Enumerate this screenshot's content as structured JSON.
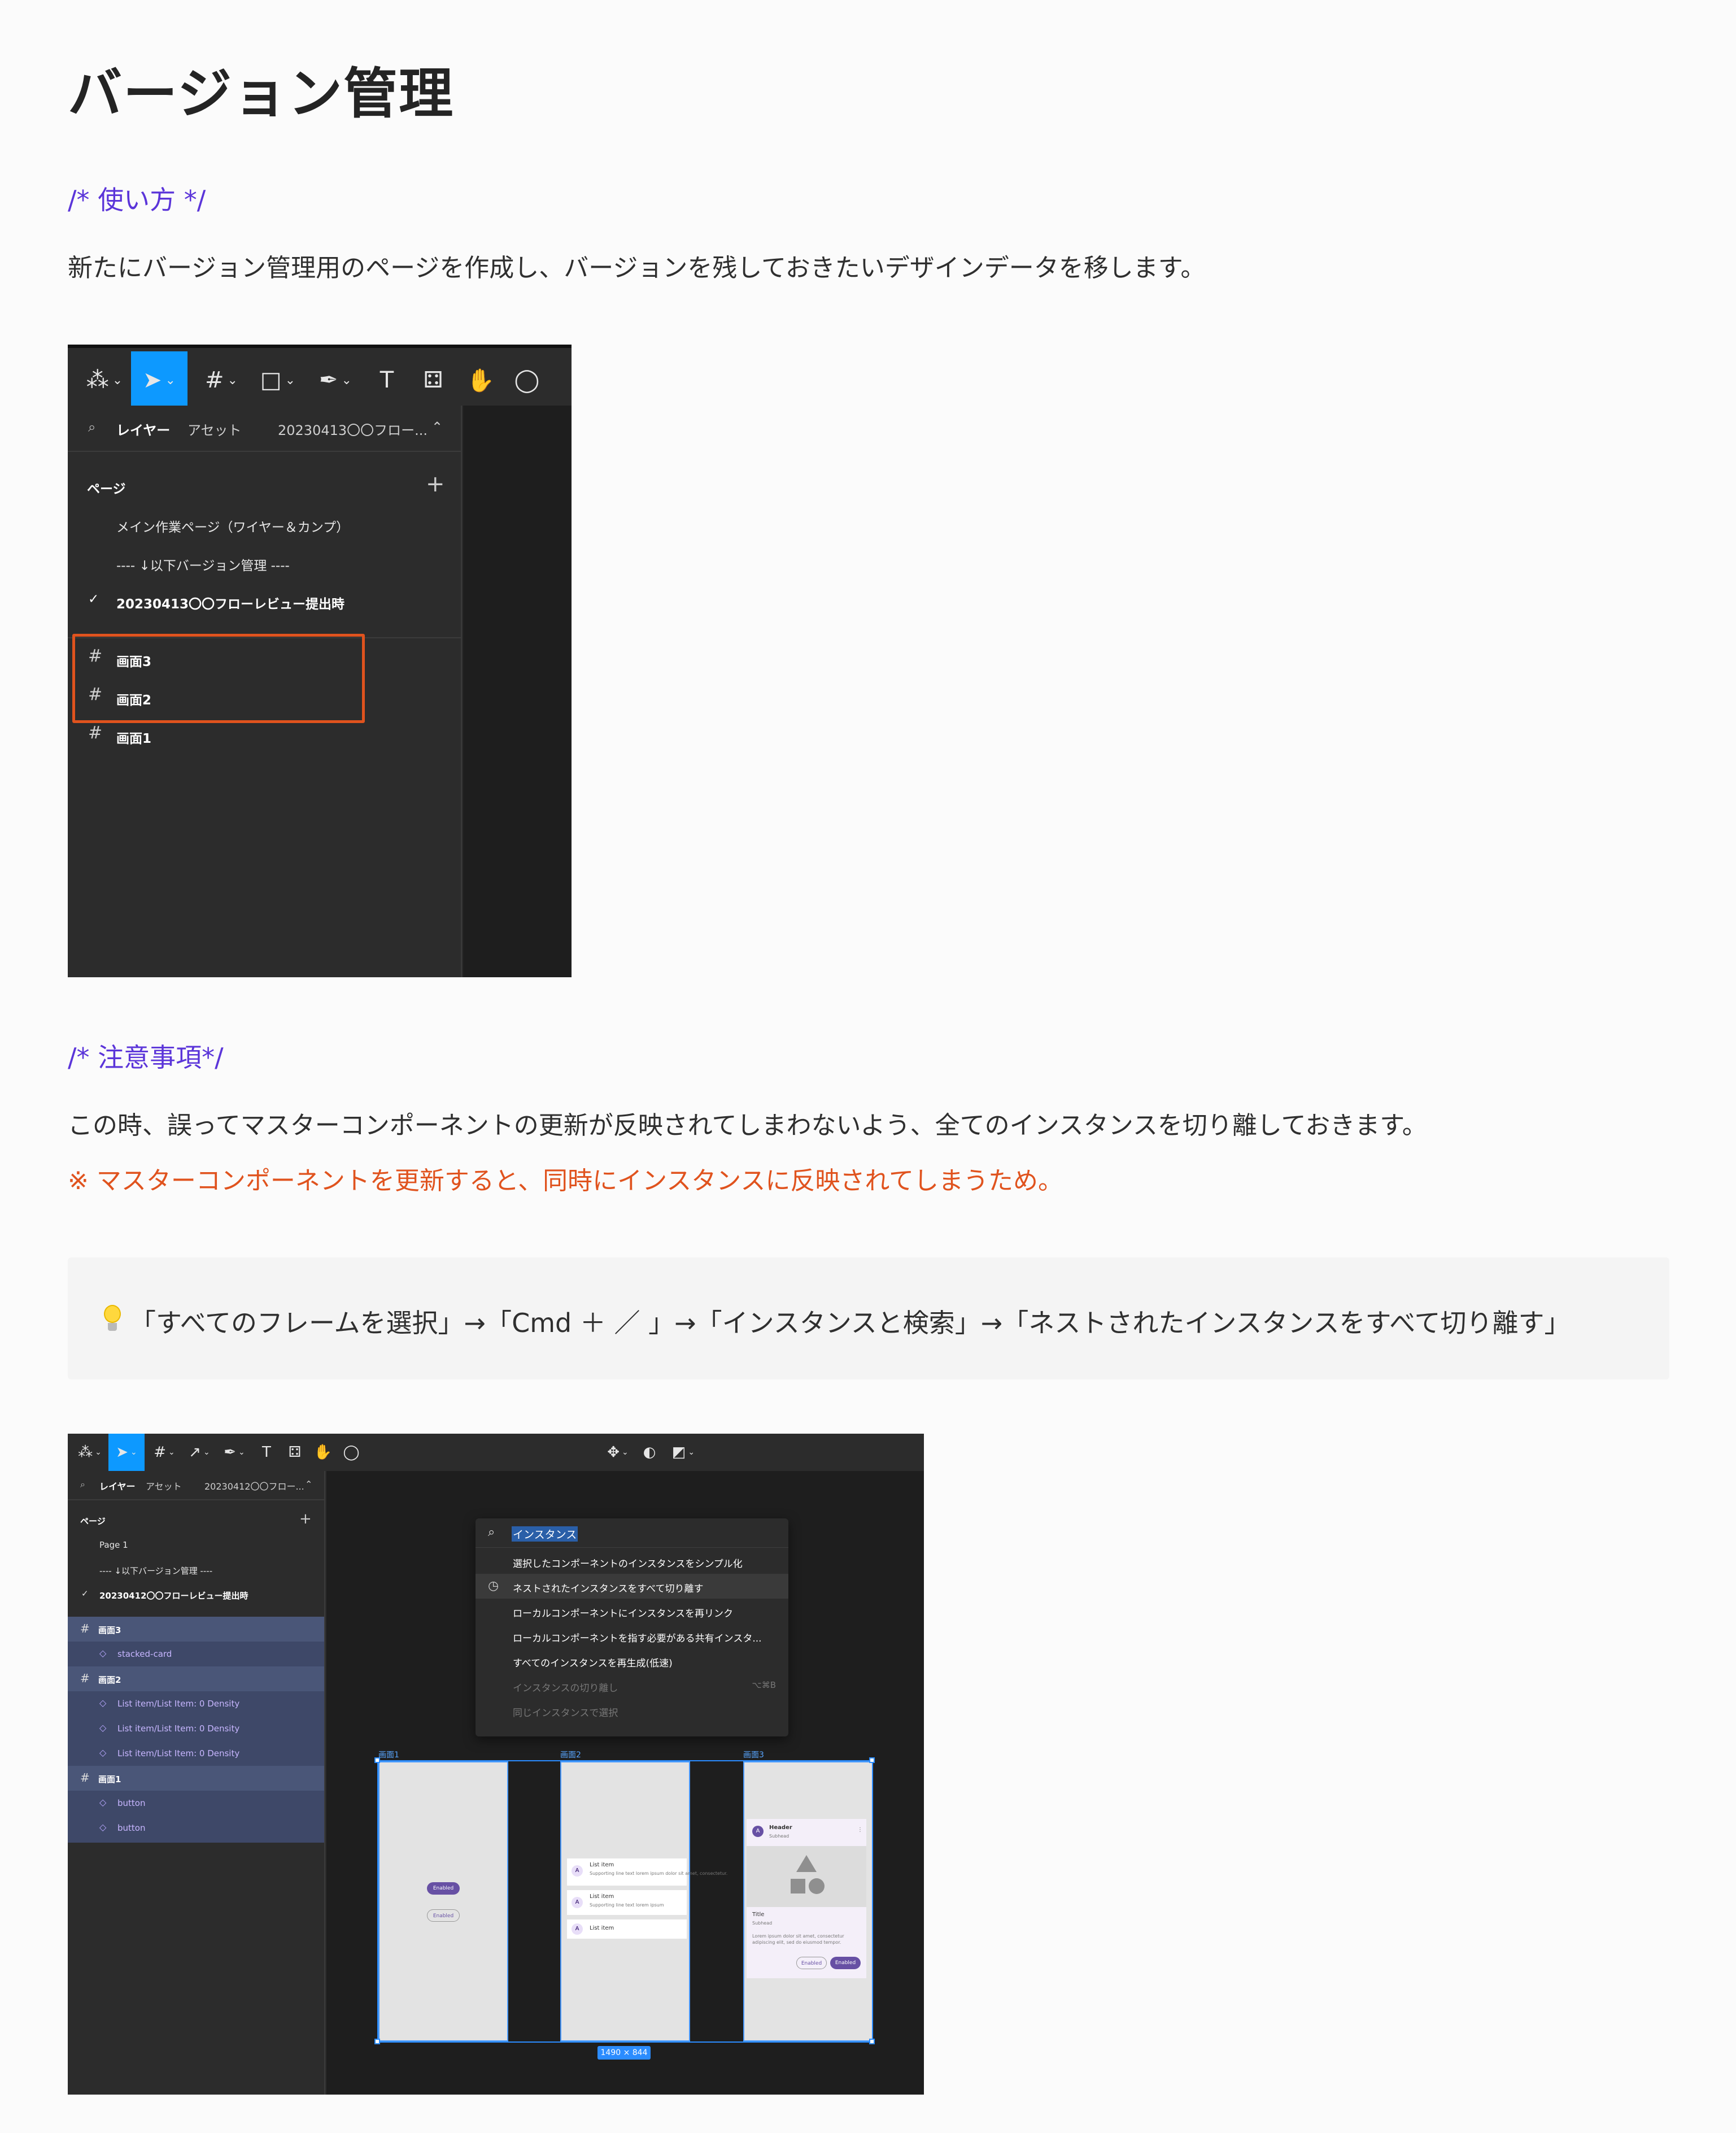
{
  "page": {
    "title": "バージョン管理",
    "section1_title": "/* 使い方 */",
    "section1_body": "新たにバージョン管理用のページを作成し、バージョンを残しておきたいデザインデータを移します。",
    "section2_title": "/* 注意事項*/",
    "section2_body": "この時、誤ってマスターコンポーネントの更新が反映されてしまわないよう、全てのインスタンスを切り離しておきます。",
    "section2_warning": "※ マスターコンポーネントを更新すると、同時にインスタンスに反映されてしまうため。",
    "callout_text": "「すべてのフレームを選択」→「Cmd ＋ ／ 」→「インスタンスと検索」→「ネストされたインスタンスをすべて切り離す」"
  },
  "colors": {
    "accent": "#5b35d9",
    "warning": "#e0531e",
    "figma_blue": "#0d99ff",
    "selection": "#3e4868"
  },
  "fig1": {
    "tab_layers": "レイヤー",
    "tab_assets": "アセット",
    "page_selector": "20230413〇〇フロー...",
    "pages_header": "ページ",
    "pages": [
      "メイン作業ページ（ワイヤー＆カンプ）",
      "---- ↓以下バージョン管理 ----",
      "20230413〇〇フローレビュー提出時"
    ],
    "layers": [
      "画面3",
      "画面2",
      "画面1"
    ]
  },
  "fig2": {
    "tab_layers": "レイヤー",
    "tab_assets": "アセット",
    "page_selector": "20230412〇〇フロー...",
    "pages_header": "ページ",
    "pages": [
      "Page 1",
      "---- ↓以下バージョン管理 ----",
      "20230412〇〇フローレビュー提出時"
    ],
    "layers": [
      {
        "name": "画面3",
        "children": [
          "stacked-card"
        ]
      },
      {
        "name": "画面2",
        "children": [
          "List item/List Item: 0 Density",
          "List item/List Item: 0 Density",
          "List item/List Item: 0 Density"
        ]
      },
      {
        "name": "画面1",
        "children": [
          "button",
          "button"
        ]
      }
    ],
    "quick_actions": {
      "query": "インスタンス",
      "items": [
        "選択したコンポーネントのインスタンスをシンプル化",
        "ネストされたインスタンスをすべて切り離す",
        "ローカルコンポーネントにインスタンスを再リンク",
        "ローカルコンポーネントを指す必要がある共有インスタ...",
        "すべてのインスタンスを再生成(低速)",
        "インスタンスの切り離し",
        "同じインスタンスで選択"
      ],
      "detach_shortcut": "⌥⌘B"
    },
    "canvas": {
      "frames": [
        "画面1",
        "画面2",
        "画面3"
      ],
      "size_badge": "1490 × 844",
      "button_filled": "Enabled",
      "button_outline": "Enabled",
      "list_item": "List item",
      "list_supporting_1": "Supporting line text lorem ipsum dolor sit amet, consectetur.",
      "list_supporting_2": "Supporting line text lorem ipsum",
      "header": "Header",
      "subhead": "Subhead",
      "card_title": "Title",
      "card_subhead": "Subhead",
      "card_body": "Lorem ipsum dolor sit amet, consectetur adipiscing elit, sed do eiusmod tempor.",
      "avatar_letter": "A"
    }
  }
}
